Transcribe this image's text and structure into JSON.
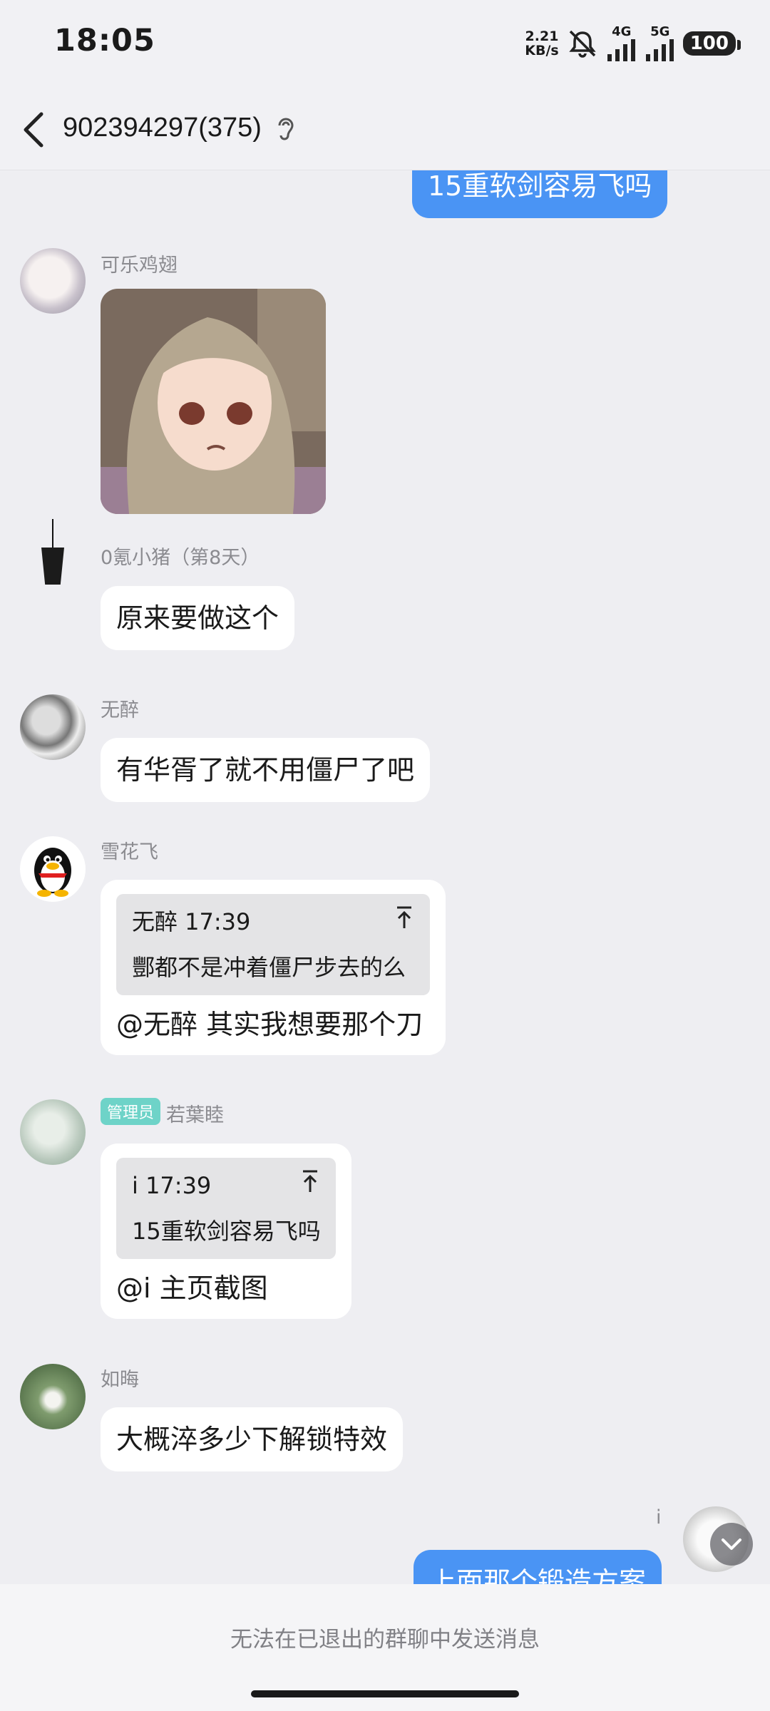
{
  "status_bar": {
    "time": "18:05",
    "net_speed_value": "2.21",
    "net_speed_unit": "KB/s",
    "signal_1": "4G",
    "signal_2": "5G",
    "battery": "100"
  },
  "header": {
    "title": "902394297(375)",
    "back_icon": "chevron-left-icon",
    "ear_icon": "ear-icon"
  },
  "messages": {
    "m0": {
      "text": "15重软剑容易飞吗"
    },
    "m1": {
      "sender": "可乐鸡翅",
      "content": "anime-character-image"
    },
    "m2": {
      "sender": "0氪小猪（第8天）",
      "text": "原来要做这个"
    },
    "m3": {
      "sender": "无醉",
      "text": "有华胥了就不用僵尸了吧"
    },
    "m4": {
      "sender": "雪花飞",
      "quote_head": "无醉 17:39",
      "quote_text": "酆都不是冲着僵尸步去的么",
      "text": "@无醉 其实我想要那个刀"
    },
    "m5": {
      "sender": "若葉睦",
      "badge": "管理员",
      "quote_head": "i 17:39",
      "quote_text": "15重软剑容易飞吗",
      "text": "@i 主页截图"
    },
    "m6": {
      "sender": "如晦",
      "text": "大概淬多少下解锁特效"
    },
    "m7": {
      "sender": "i",
      "text": "上面那个锻造方案"
    }
  },
  "footer": {
    "notice": "无法在已退出的群聊中发送消息"
  },
  "colors": {
    "accent_bubble": "#4a94f4",
    "background": "#eeeef2",
    "admin_badge": "#6ed3c8"
  }
}
